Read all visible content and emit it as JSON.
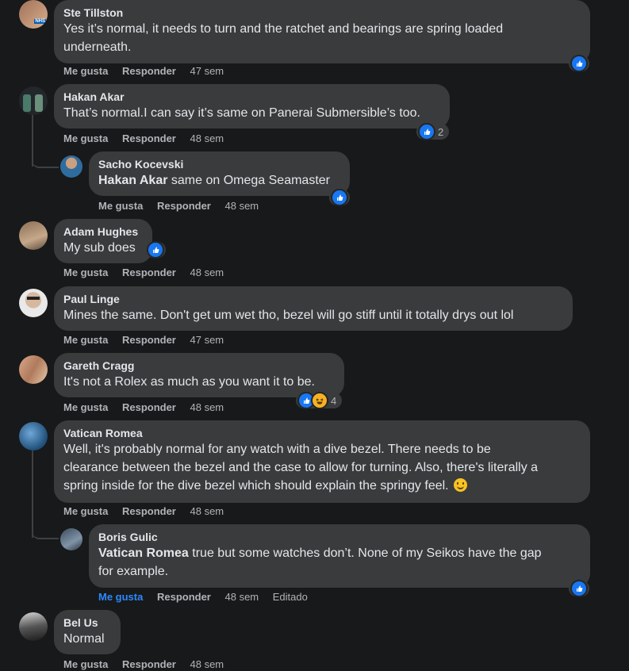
{
  "actions": {
    "like": "Me gusta",
    "reply": "Responder"
  },
  "comments": [
    {
      "author": "Ste Tillston",
      "avatar_badge": "NHS",
      "line1": "Yes it’s normal, it needs to turn and the ratchet and bearings are spring loaded",
      "line2": "underneath.",
      "time": "47 sem"
    },
    {
      "author": "Hakan Akar",
      "text": "That’s normal.I can say it’s same on Panerai Submersible’s too.",
      "time": "48 sem",
      "reaction_count": "2"
    },
    {
      "author": "Sacho Kocevski",
      "mention": "Hakan Akar",
      "text": " same on Omega Seamaster",
      "time": "48 sem"
    },
    {
      "author": "Adam Hughes",
      "text": "My sub does",
      "time": "48 sem"
    },
    {
      "author": "Paul Linge",
      "text": "Mines the same. Don't get um wet tho, bezel will go stiff until it totally drys out lol",
      "time": "47 sem"
    },
    {
      "author": "Gareth Cragg",
      "text": "It's not a Rolex as much as you want it to be.",
      "time": "48 sem",
      "reaction_count": "4"
    },
    {
      "author": "Vatican Romea",
      "line1": "Well, it's probably normal for any watch with a dive bezel. There needs to be",
      "line2": "clearance between the bezel and the case to allow for turning. Also, there's literally a",
      "line3": "spring inside for the dive bezel which should explain the springy feel.",
      "time": "48 sem"
    },
    {
      "author": "Boris Gulic",
      "mention": "Vatican Romea",
      "line1": " true but some watches don’t. None of my Seikos have the gap",
      "line2": "for example.",
      "time": "48 sem",
      "edited": "Editado"
    },
    {
      "author": "Bel Us",
      "text": "Normal",
      "time": "48 sem"
    }
  ],
  "colors": {
    "background": "#18191a",
    "bubble": "#3a3b3c",
    "like_blue": "#1877f2",
    "liked_text": "#2d88ff"
  }
}
